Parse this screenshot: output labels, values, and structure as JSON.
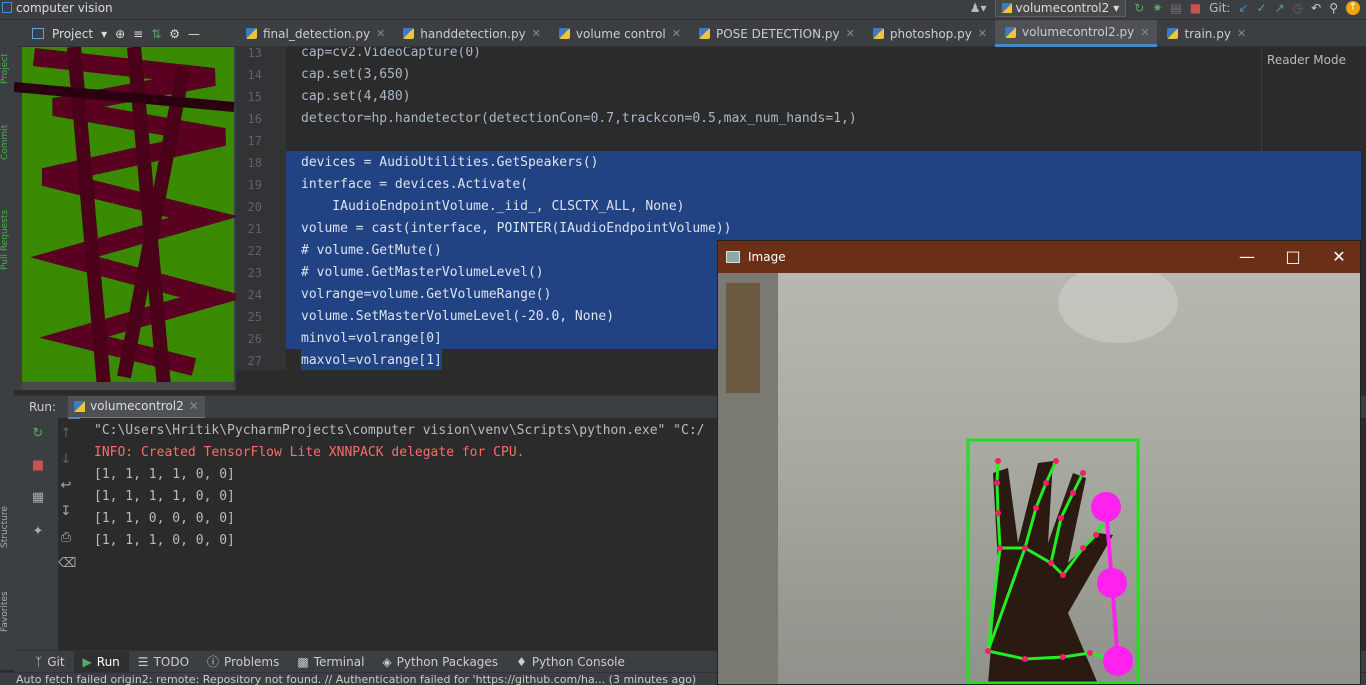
{
  "window": {
    "title": "computer vision"
  },
  "toolbar": {
    "run_config": "volumecontrol2",
    "git_label": "Git:"
  },
  "project": {
    "label": "Project"
  },
  "tabs": [
    {
      "label": "final_detection.py"
    },
    {
      "label": "handdetection.py"
    },
    {
      "label": "volume control"
    },
    {
      "label": "POSE DETECTION.py"
    },
    {
      "label": "photoshop.py"
    },
    {
      "label": "volumecontrol2.py"
    },
    {
      "label": "train.py"
    }
  ],
  "editor": {
    "reader_mode": "Reader Mode",
    "lines": [
      {
        "num": "13",
        "text": "cap=cv2.VideoCapture(0)"
      },
      {
        "num": "14",
        "text": "cap.set(3,650)"
      },
      {
        "num": "15",
        "text": "cap.set(4,480)"
      },
      {
        "num": "16",
        "text": "detector=hp.handetector(detectionCon=0.7,trackcon=0.5,max_num_hands=1,)"
      },
      {
        "num": "17",
        "text": ""
      },
      {
        "num": "18",
        "text": "devices = AudioUtilities.GetSpeakers()"
      },
      {
        "num": "19",
        "text": "interface = devices.Activate("
      },
      {
        "num": "20",
        "text": "    IAudioEndpointVolume._iid_, CLSCTX_ALL, None)"
      },
      {
        "num": "21",
        "text": "volume = cast(interface, POINTER(IAudioEndpointVolume))"
      },
      {
        "num": "22",
        "text": "# volume.GetMute()"
      },
      {
        "num": "23",
        "text": "# volume.GetMasterVolumeLevel()"
      },
      {
        "num": "24",
        "text": "volrange=volume.GetVolumeRange()"
      },
      {
        "num": "25",
        "text": "volume.SetMasterVolumeLevel(-20.0, None)"
      },
      {
        "num": "26",
        "text": "minvol=volrange[0]"
      },
      {
        "num": "27",
        "text": "maxvol=volrange[1]"
      }
    ]
  },
  "run": {
    "label": "Run:",
    "tab": "volumecontrol2",
    "console": [
      "\"C:\\Users\\Hritik\\PycharmProjects\\computer vision\\venv\\Scripts\\python.exe\" \"C:/",
      "INFO: Created TensorFlow Lite XNNPACK delegate for CPU.",
      "[1, 1, 1, 1, 0, 0]",
      "[1, 1, 1, 1, 0, 0]",
      "[1, 1, 0, 0, 0, 0]",
      "[1, 1, 1, 0, 0, 0]"
    ]
  },
  "bottom_tools": [
    {
      "label": "Git"
    },
    {
      "label": "Run"
    },
    {
      "label": "TODO"
    },
    {
      "label": "Problems"
    },
    {
      "label": "Terminal"
    },
    {
      "label": "Python Packages"
    },
    {
      "label": "Python Console"
    }
  ],
  "status": {
    "message": "Auto fetch failed origin2: remote: Repository not found. // Authentication failed for 'https://github.com/ha... (3 minutes ago)"
  },
  "image_window": {
    "title": "Image"
  }
}
